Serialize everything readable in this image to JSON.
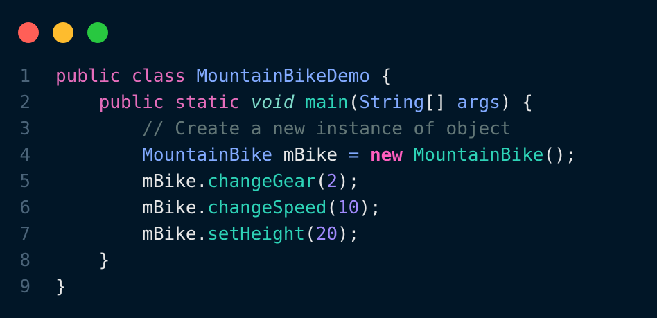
{
  "window": {
    "controls": [
      {
        "name": "close",
        "color": "#ff5f57"
      },
      {
        "name": "minimize",
        "color": "#febc2e"
      },
      {
        "name": "zoom",
        "color": "#28c840"
      }
    ]
  },
  "code": {
    "lines": [
      {
        "number": "1",
        "tokens": [
          {
            "t": "public",
            "c": "kw"
          },
          {
            "t": " ",
            "c": "src"
          },
          {
            "t": "class",
            "c": "kw"
          },
          {
            "t": " ",
            "c": "src"
          },
          {
            "t": "MountainBikeDemo",
            "c": "type"
          },
          {
            "t": " {",
            "c": "punct"
          }
        ]
      },
      {
        "number": "2",
        "tokens": [
          {
            "t": "    ",
            "c": "src"
          },
          {
            "t": "public",
            "c": "kw"
          },
          {
            "t": " ",
            "c": "src"
          },
          {
            "t": "static",
            "c": "kw"
          },
          {
            "t": " ",
            "c": "src"
          },
          {
            "t": "void",
            "c": "void"
          },
          {
            "t": " ",
            "c": "src"
          },
          {
            "t": "main",
            "c": "fn"
          },
          {
            "t": "(",
            "c": "punct"
          },
          {
            "t": "String",
            "c": "type"
          },
          {
            "t": "[] ",
            "c": "punct"
          },
          {
            "t": "args",
            "c": "type"
          },
          {
            "t": ") {",
            "c": "punct"
          }
        ]
      },
      {
        "number": "3",
        "tokens": [
          {
            "t": "        ",
            "c": "src"
          },
          {
            "t": "// Create a new instance of object",
            "c": "cmt"
          }
        ]
      },
      {
        "number": "4",
        "tokens": [
          {
            "t": "        ",
            "c": "src"
          },
          {
            "t": "MountainBike",
            "c": "type"
          },
          {
            "t": " mBike ",
            "c": "src"
          },
          {
            "t": "=",
            "c": "type"
          },
          {
            "t": " ",
            "c": "src"
          },
          {
            "t": "new",
            "c": "new"
          },
          {
            "t": " ",
            "c": "src"
          },
          {
            "t": "MountainBike",
            "c": "fn"
          },
          {
            "t": "();",
            "c": "punct"
          }
        ]
      },
      {
        "number": "5",
        "tokens": [
          {
            "t": "        ",
            "c": "src"
          },
          {
            "t": "mBike.",
            "c": "src"
          },
          {
            "t": "changeGear",
            "c": "fn"
          },
          {
            "t": "(",
            "c": "punct"
          },
          {
            "t": "2",
            "c": "num"
          },
          {
            "t": ");",
            "c": "punct"
          }
        ]
      },
      {
        "number": "6",
        "tokens": [
          {
            "t": "        ",
            "c": "src"
          },
          {
            "t": "mBike.",
            "c": "src"
          },
          {
            "t": "changeSpeed",
            "c": "fn"
          },
          {
            "t": "(",
            "c": "punct"
          },
          {
            "t": "10",
            "c": "num"
          },
          {
            "t": ");",
            "c": "punct"
          }
        ]
      },
      {
        "number": "7",
        "tokens": [
          {
            "t": "        ",
            "c": "src"
          },
          {
            "t": "mBike.",
            "c": "src"
          },
          {
            "t": "setHeight",
            "c": "fn"
          },
          {
            "t": "(",
            "c": "punct"
          },
          {
            "t": "20",
            "c": "num"
          },
          {
            "t": ");",
            "c": "punct"
          }
        ]
      },
      {
        "number": "8",
        "tokens": [
          {
            "t": "    ",
            "c": "src"
          },
          {
            "t": "}",
            "c": "punct"
          }
        ]
      },
      {
        "number": "9",
        "tokens": [
          {
            "t": "}",
            "c": "punct"
          }
        ]
      }
    ]
  }
}
